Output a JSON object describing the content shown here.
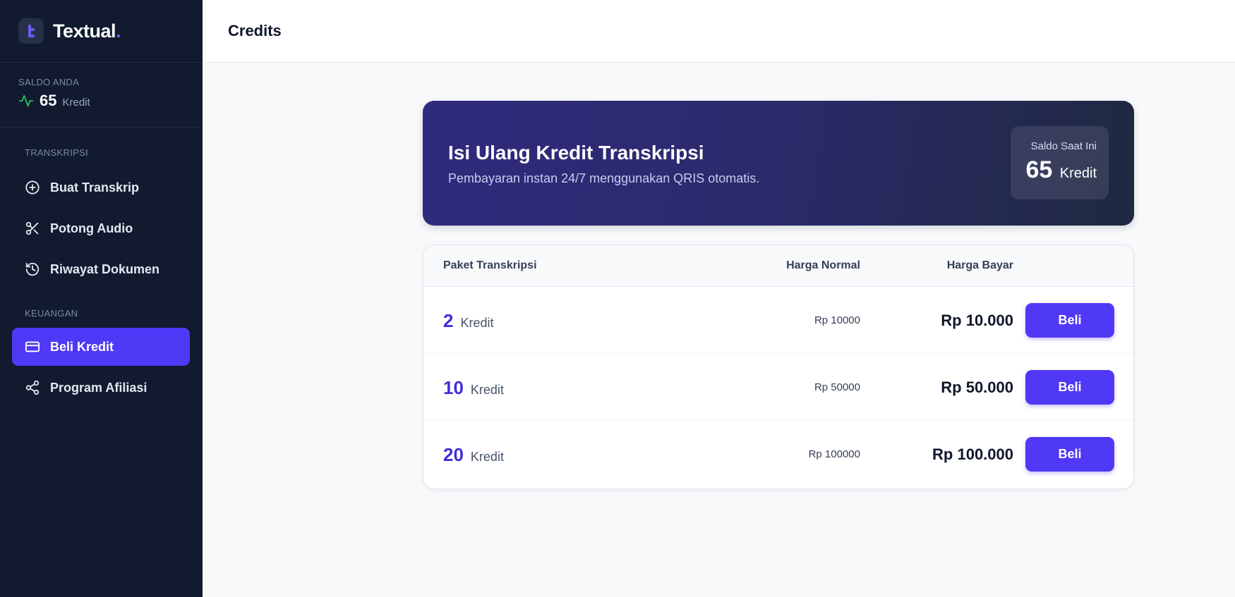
{
  "brand": {
    "name": "Textual",
    "dot": "."
  },
  "balance": {
    "label": "SALDO ANDA",
    "value": "65",
    "unit": "Kredit"
  },
  "sidebar": {
    "sections": [
      {
        "label": "TRANSKRIPSI"
      },
      {
        "label": "KEUANGAN"
      }
    ],
    "items": [
      {
        "label": "Buat Transkrip",
        "icon": "plus-circle-icon"
      },
      {
        "label": "Potong Audio",
        "icon": "scissors-icon"
      },
      {
        "label": "Riwayat Dokumen",
        "icon": "history-icon"
      },
      {
        "label": "Beli Kredit",
        "icon": "credit-card-icon",
        "active": true
      },
      {
        "label": "Program Afiliasi",
        "icon": "share-icon"
      }
    ]
  },
  "header": {
    "title": "Credits"
  },
  "hero": {
    "title": "Isi Ulang Kredit Transkripsi",
    "subtitle": "Pembayaran instan 24/7 menggunakan QRIS otomatis.",
    "badge_label": "Saldo Saat Ini",
    "badge_value": "65",
    "badge_unit": "Kredit"
  },
  "table": {
    "columns": {
      "paket": "Paket Transkripsi",
      "normal": "Harga Normal",
      "bayar": "Harga Bayar"
    },
    "rows": [
      {
        "qty": "2",
        "unit": "Kredit",
        "normal": "Rp 10000",
        "bayar": "Rp 10.000",
        "button": "Beli"
      },
      {
        "qty": "10",
        "unit": "Kredit",
        "normal": "Rp 50000",
        "bayar": "Rp 50.000",
        "button": "Beli"
      },
      {
        "qty": "20",
        "unit": "Kredit",
        "normal": "Rp 100000",
        "bayar": "Rp 100.000",
        "button": "Beli"
      }
    ]
  },
  "colors": {
    "sidebar_bg": "#111a2e",
    "accent": "#4f39f6",
    "balance_pulse": "#22c55e"
  }
}
